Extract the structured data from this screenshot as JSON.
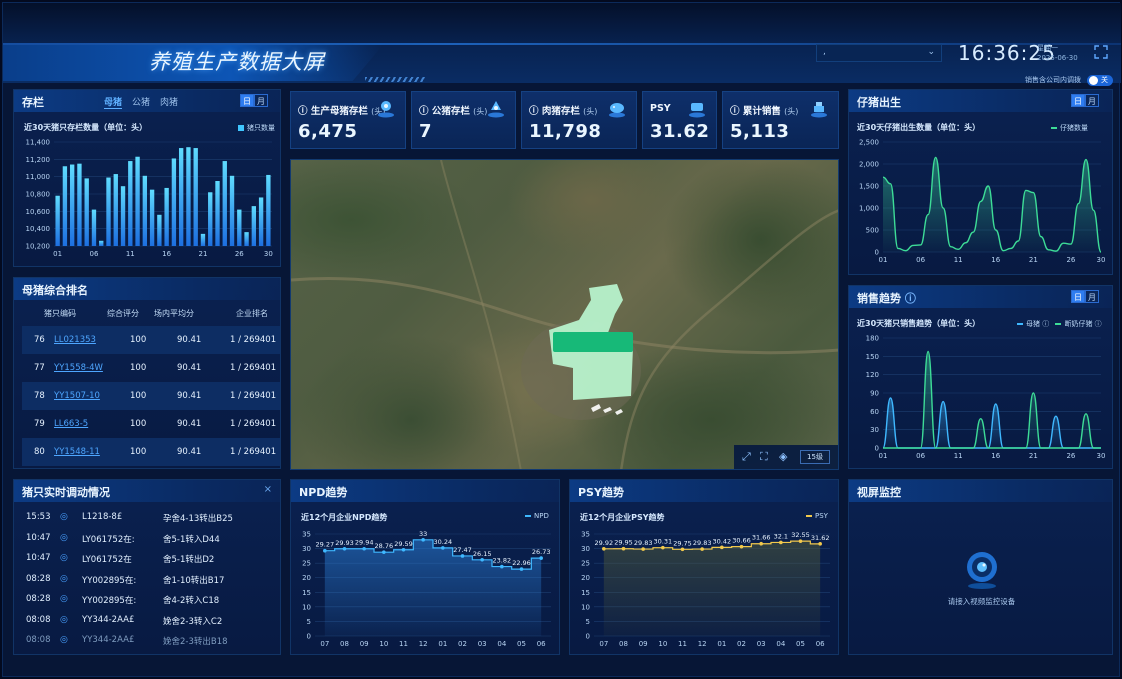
{
  "header": {
    "title": "养殖生产数据大屏",
    "company_select": ",",
    "time": "16:36:25",
    "weekday": "星期一",
    "date": "2025-06-30",
    "toggle_label": "销售含公司内调拨",
    "toggle_state": "关"
  },
  "stats": [
    {
      "label": "生产母猪存栏",
      "unit": "(头)",
      "value": "6,475",
      "icon": "sow-location-icon"
    },
    {
      "label": "公猪存栏",
      "unit": "(头)",
      "value": "7",
      "icon": "boar-icon"
    },
    {
      "label": "肉猪存栏",
      "unit": "(头)",
      "value": "11,798",
      "icon": "pig-icon"
    },
    {
      "label": "PSY",
      "unit": "",
      "value": "31.62",
      "icon": "psy-icon"
    },
    {
      "label": "累计销售",
      "unit": "(头)",
      "value": "5,113",
      "icon": "sales-icon"
    }
  ],
  "inventory": {
    "title": "存栏",
    "tabs": [
      "母猪",
      "公猪",
      "肉猪"
    ],
    "active_tab": "母猪",
    "period": [
      "日",
      "月"
    ],
    "subtitle": "近30天猪只存栏数量（单位：头）",
    "legend": "猪只数量"
  },
  "ranking": {
    "title": "母猪综合排名",
    "headers": [
      "猪只编码",
      "综合评分",
      "场内平均分",
      "企业排名"
    ],
    "rows": [
      {
        "no": "76",
        "code": "LL021353",
        "score": "100",
        "avg": "90.41",
        "rank": "1 / 269401"
      },
      {
        "no": "77",
        "code": "YY1558-4W",
        "score": "100",
        "avg": "90.41",
        "rank": "1 / 269401"
      },
      {
        "no": "78",
        "code": "YY1507-10",
        "score": "100",
        "avg": "90.41",
        "rank": "1 / 269401"
      },
      {
        "no": "79",
        "code": "LL663-5",
        "score": "100",
        "avg": "90.41",
        "rank": "1 / 269401"
      },
      {
        "no": "80",
        "code": "YY1548-11",
        "score": "100",
        "avg": "90.41",
        "rank": "1 / 269401"
      }
    ]
  },
  "transfers": {
    "title": "猪只实时调动情况",
    "close": "×",
    "rows": [
      {
        "time": "15:53",
        "pig": "L1218-8£",
        "desc": "孕舍4-13转出B25"
      },
      {
        "time": "10:47",
        "pig": "LY061752在:",
        "desc": "舍5-1转入D44"
      },
      {
        "time": "10:47",
        "pig": "LY061752在",
        "desc": "舍5-1转出D2"
      },
      {
        "time": "08:28",
        "pig": "YY002895在:",
        "desc": "舍1-10转出B17"
      },
      {
        "time": "08:28",
        "pig": "YY002895在:",
        "desc": "舍4-2转入C18"
      },
      {
        "time": "08:08",
        "pig": "YY344-2AA£",
        "desc": "娩舍2-3转入C2"
      },
      {
        "time": "08:08",
        "pig": "YY344-2AA£",
        "desc": "娩舍2-3转出B18"
      }
    ]
  },
  "piglet": {
    "title": "仔猪出生",
    "period": [
      "日",
      "月"
    ],
    "subtitle": "近30天仔猪出生数量（单位：头）",
    "legend": "仔猪数量"
  },
  "sales": {
    "title": "销售趋势",
    "period": [
      "日",
      "月"
    ],
    "subtitle": "近30天猪只销售趋势（单位：头）",
    "legend1": "母猪",
    "legend2": "断奶仔猪"
  },
  "npd": {
    "title": "NPD趋势",
    "subtitle": "近12个月企业NPD趋势",
    "legend": "NPD"
  },
  "psy": {
    "title": "PSY趋势",
    "subtitle": "近12个月企业PSY趋势",
    "legend": "PSY"
  },
  "video": {
    "title": "视屏监控",
    "message": "请接入视频监控设备"
  },
  "map": {
    "zoom": "15级"
  },
  "colors": {
    "accent": "#2e7cf0",
    "bar": "#3fc6ff",
    "green": "#3ddc97",
    "yellow": "#f2c94c"
  },
  "chart_data": [
    {
      "type": "bar",
      "title": "近30天猪只存栏数量（单位：头）",
      "categories": [
        "01",
        "02",
        "03",
        "04",
        "05",
        "06",
        "07",
        "08",
        "09",
        "10",
        "11",
        "12",
        "13",
        "14",
        "15",
        "16",
        "17",
        "18",
        "19",
        "20",
        "21",
        "22",
        "23",
        "24",
        "25",
        "26",
        "27",
        "28",
        "29",
        "30"
      ],
      "tick_labels": [
        "01",
        "06",
        "11",
        "16",
        "21",
        "26",
        "30"
      ],
      "series": [
        {
          "name": "猪只数量",
          "values": [
            10780,
            11120,
            11140,
            11150,
            10980,
            10620,
            10260,
            10990,
            11030,
            10890,
            11180,
            11230,
            11010,
            10850,
            10560,
            10870,
            11210,
            11330,
            11340,
            11330,
            10340,
            10820,
            10950,
            11180,
            11010,
            10620,
            10360,
            10660,
            10760,
            11020
          ]
        }
      ],
      "ylim": [
        10200,
        11400
      ],
      "yticks": [
        10200,
        10400,
        10600,
        10800,
        11000,
        11200,
        11400
      ]
    },
    {
      "type": "area",
      "title": "近30天仔猪出生数量（单位：头）",
      "x": [
        "01",
        "02",
        "03",
        "04",
        "05",
        "06",
        "07",
        "08",
        "09",
        "10",
        "11",
        "12",
        "13",
        "14",
        "15",
        "16",
        "17",
        "18",
        "19",
        "20",
        "21",
        "22",
        "23",
        "24",
        "25",
        "26",
        "27",
        "28",
        "29",
        "30"
      ],
      "tick_labels": [
        "01",
        "06",
        "11",
        "16",
        "21",
        "26",
        "30"
      ],
      "series": [
        {
          "name": "仔猪数量",
          "values": [
            1700,
            1550,
            80,
            30,
            150,
            160,
            850,
            2150,
            1000,
            120,
            60,
            210,
            450,
            1150,
            1500,
            500,
            30,
            80,
            250,
            1400,
            1350,
            350,
            50,
            20,
            200,
            180,
            1100,
            2100,
            950,
            0
          ]
        }
      ],
      "ylim": [
        0,
        2500
      ],
      "yticks": [
        0,
        500,
        1000,
        1500,
        2000,
        2500
      ]
    },
    {
      "type": "area",
      "title": "近30天猪只销售趋势（单位：头）",
      "x": [
        "01",
        "02",
        "03",
        "04",
        "05",
        "06",
        "07",
        "08",
        "09",
        "10",
        "11",
        "12",
        "13",
        "14",
        "15",
        "16",
        "17",
        "18",
        "19",
        "20",
        "21",
        "22",
        "23",
        "24",
        "25",
        "26",
        "27",
        "28",
        "29",
        "30"
      ],
      "tick_labels": [
        "01",
        "06",
        "11",
        "16",
        "21",
        "26",
        "30"
      ],
      "series": [
        {
          "name": "母猪",
          "values": [
            0,
            82,
            0,
            0,
            0,
            0,
            0,
            0,
            76,
            0,
            0,
            0,
            0,
            0,
            0,
            72,
            0,
            0,
            0,
            0,
            0,
            0,
            0,
            52,
            0,
            0,
            0,
            0,
            0,
            0
          ]
        },
        {
          "name": "断奶仔猪",
          "values": [
            0,
            0,
            0,
            0,
            0,
            0,
            158,
            0,
            0,
            0,
            0,
            0,
            0,
            48,
            0,
            0,
            0,
            0,
            0,
            0,
            90,
            0,
            0,
            0,
            0,
            0,
            0,
            56,
            0,
            0
          ]
        }
      ],
      "ylim": [
        0,
        180
      ],
      "yticks": [
        0,
        30,
        60,
        90,
        120,
        150,
        180
      ]
    },
    {
      "type": "line",
      "title": "近12个月企业NPD趋势",
      "categories": [
        "07",
        "08",
        "09",
        "10",
        "11",
        "12",
        "01",
        "02",
        "03",
        "04",
        "05",
        "06"
      ],
      "series": [
        {
          "name": "NPD",
          "values": [
            29.27,
            29.93,
            29.94,
            28.76,
            29.59,
            33,
            30.24,
            27.47,
            26.15,
            23.82,
            22.96,
            26.73
          ]
        }
      ],
      "ylim": [
        0,
        35
      ],
      "yticks": [
        0,
        5,
        10,
        15,
        20,
        25,
        30,
        35
      ]
    },
    {
      "type": "line",
      "title": "近12个月企业PSY趋势",
      "categories": [
        "07",
        "08",
        "09",
        "10",
        "11",
        "12",
        "01",
        "02",
        "03",
        "04",
        "05",
        "06"
      ],
      "series": [
        {
          "name": "PSY",
          "values": [
            29.92,
            29.95,
            29.83,
            30.31,
            29.75,
            29.83,
            30.42,
            30.66,
            31.66,
            32.1,
            32.55,
            31.62
          ]
        }
      ],
      "ylim": [
        0,
        35
      ],
      "yticks": [
        0,
        5,
        10,
        15,
        20,
        25,
        30,
        35
      ]
    }
  ]
}
